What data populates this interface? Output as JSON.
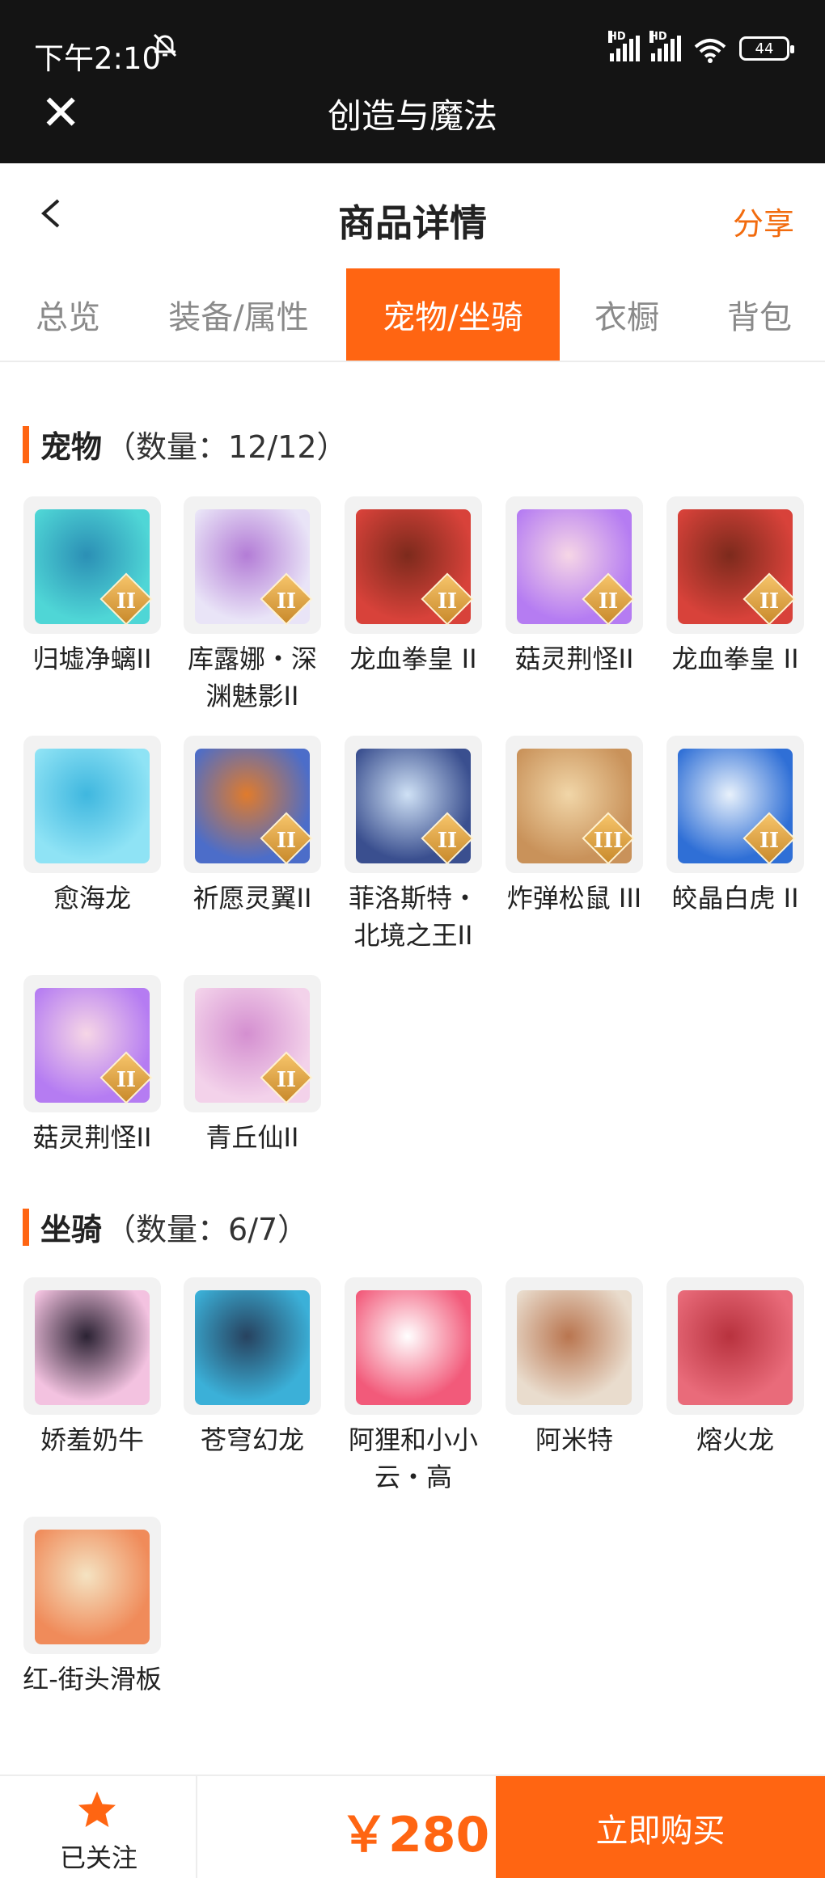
{
  "status_bar": {
    "time": "下午2:10",
    "battery": "44"
  },
  "app_bar": {
    "title": "创造与魔法"
  },
  "header": {
    "title": "商品详情",
    "share": "分享"
  },
  "tabs": [
    {
      "label": "总览",
      "active": false
    },
    {
      "label": "装备/属性",
      "active": false
    },
    {
      "label": "宠物/坐骑",
      "active": true
    },
    {
      "label": "衣橱",
      "active": false
    },
    {
      "label": "背包",
      "active": false
    }
  ],
  "pets": {
    "title": "宠物",
    "count": "（数量：12/12）",
    "items": [
      {
        "name": "归墟净螭II",
        "badge": "II",
        "colors": [
          "#4fd6d6",
          "#2b8fb5"
        ]
      },
      {
        "name": "库露娜・深渊魅影II",
        "badge": "II",
        "colors": [
          "#e9e4f7",
          "#b37cd6"
        ]
      },
      {
        "name": "龙血拳皇 II",
        "badge": "II",
        "colors": [
          "#d8423a",
          "#7c2a1c"
        ]
      },
      {
        "name": "菇灵荆怪II",
        "badge": "II",
        "colors": [
          "#b57cf2",
          "#f6d6e6"
        ]
      },
      {
        "name": "龙血拳皇 II",
        "badge": "II",
        "colors": [
          "#d8423a",
          "#7c2a1c"
        ]
      },
      {
        "name": "愈海龙",
        "badge": "",
        "colors": [
          "#8fe3f5",
          "#3fb7df"
        ]
      },
      {
        "name": "祈愿灵翼II",
        "badge": "II",
        "colors": [
          "#4c6dc9",
          "#e07b2c"
        ]
      },
      {
        "name": "菲洛斯特・北境之王II",
        "badge": "II",
        "colors": [
          "#3a4f8f",
          "#cfe1f5"
        ]
      },
      {
        "name": "炸弹松鼠 III",
        "badge": "III",
        "colors": [
          "#c9925a",
          "#f1d6a8"
        ]
      },
      {
        "name": "皎晶白虎 II",
        "badge": "II",
        "colors": [
          "#2f6fd6",
          "#e8f1fb"
        ]
      },
      {
        "name": "菇灵荆怪II",
        "badge": "II",
        "colors": [
          "#b57cf2",
          "#f6d6e6"
        ]
      },
      {
        "name": "青丘仙II",
        "badge": "II",
        "colors": [
          "#f3d2ea",
          "#d48fd0"
        ]
      }
    ]
  },
  "mounts": {
    "title": "坐骑",
    "count": "（数量：6/7）",
    "items": [
      {
        "name": "娇羞奶牛",
        "colors": [
          "#f3c2e0",
          "#2b2233"
        ]
      },
      {
        "name": "苍穹幻龙",
        "colors": [
          "#3bb0d8",
          "#27425f"
        ]
      },
      {
        "name": "阿狸和小小云・高",
        "colors": [
          "#f25a7a",
          "#ffffff"
        ]
      },
      {
        "name": "阿米特",
        "colors": [
          "#e9dccd",
          "#b9754f"
        ]
      },
      {
        "name": "熔火龙",
        "colors": [
          "#e96b7a",
          "#b8323e"
        ]
      },
      {
        "name": "红-街头滑板",
        "colors": [
          "#f08b5a",
          "#f4e3c2"
        ]
      }
    ]
  },
  "bottom": {
    "follow": "已关注",
    "price": "￥280",
    "buy": "立即购买"
  }
}
